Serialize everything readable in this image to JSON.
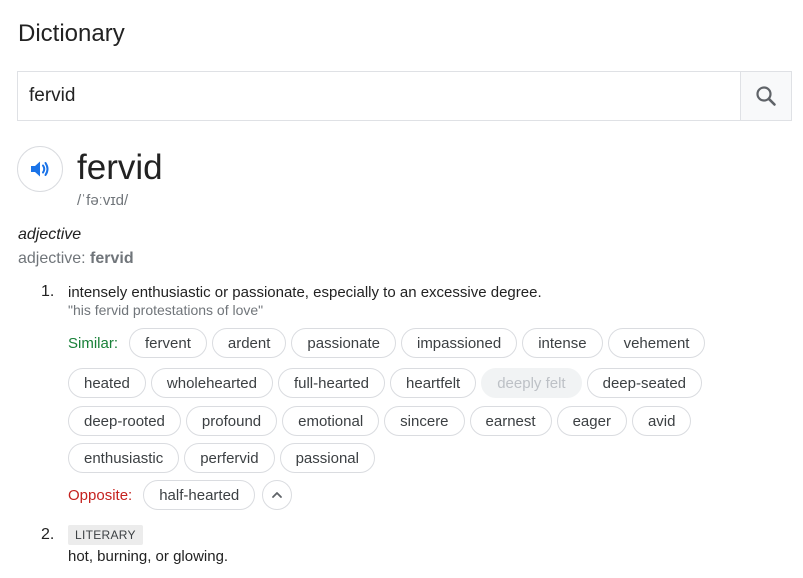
{
  "title": "Dictionary",
  "search": {
    "value": "fervid",
    "icon": "search-icon"
  },
  "entry": {
    "word": "fervid",
    "phonetic": "/ˈfəːvɪd/",
    "audio_icon": "speaker-icon",
    "part_of_speech": "adjective",
    "pos_prefix": "adjective: ",
    "pos_word": "fervid"
  },
  "senses": [
    {
      "number": "1.",
      "definition": "intensely enthusiastic or passionate, especially to an excessive degree.",
      "example": "\"his fervid protestations of love\"",
      "similar_label": "Similar:",
      "similar": [
        "fervent",
        "ardent",
        "passionate",
        "impassioned",
        "intense",
        "vehement",
        "heated",
        "wholehearted",
        "full-hearted",
        "heartfelt",
        "deeply felt",
        "deep-seated",
        "deep-rooted",
        "profound",
        "emotional",
        "sincere",
        "earnest",
        "eager",
        "avid",
        "enthusiastic",
        "perfervid",
        "passional"
      ],
      "opposite_label": "Opposite:",
      "opposite": [
        "half-hearted"
      ]
    },
    {
      "number": "2.",
      "register": "LITERARY",
      "definition": "hot, burning, or glowing."
    }
  ],
  "colors": {
    "accent_blue": "#1a73e8",
    "similar_green": "#188038",
    "opposite_red": "#c5221f"
  }
}
